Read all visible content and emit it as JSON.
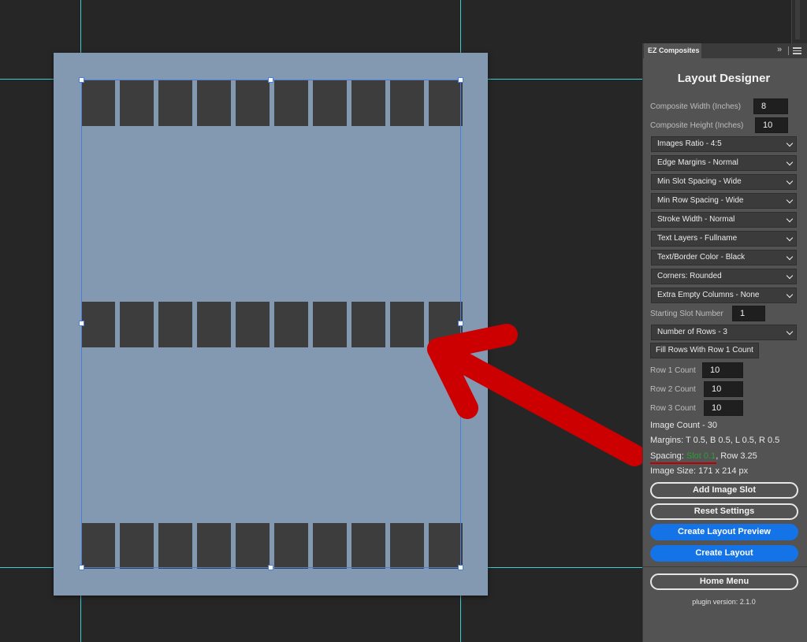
{
  "panel": {
    "tab_label": "EZ Composites",
    "collapse_icon": "double-chevron-right-icon",
    "menu_icon": "hamburger-menu-icon",
    "title": "Layout Designer",
    "composite_width_label": "Composite Width (Inches)",
    "composite_width_value": "8",
    "composite_height_label": "Composite Height (Inches)",
    "composite_height_value": "10",
    "dropdowns": [
      "Images Ratio - 4:5",
      "Edge Margins - Normal",
      "Min Slot Spacing - Wide",
      "Min Row Spacing - Wide",
      "Stroke Width - Normal",
      "Text Layers - Fullname",
      "Text/Border Color - Black",
      "Corners: Rounded",
      "Extra Empty Columns - None"
    ],
    "starting_slot_label": "Starting Slot Number",
    "starting_slot_value": "1",
    "rows_dropdown": "Number of Rows - 3",
    "fill_rows_button": "Fill Rows With Row 1 Count",
    "row_counts": [
      {
        "label": "Row 1 Count",
        "value": "10"
      },
      {
        "label": "Row 2 Count",
        "value": "10"
      },
      {
        "label": "Row 3 Count",
        "value": "10"
      }
    ],
    "image_count": "Image Count - 30",
    "margins": "Margins: T 0.5, B 0.5, L 0.5, R 0.5",
    "spacing_prefix": "Spacing: ",
    "spacing_slot": "Slot 0.1",
    "spacing_row": ", Row 3.25",
    "image_size": "Image Size: 171 x 214 px",
    "add_slot_button": "Add Image Slot",
    "reset_button": "Reset Settings",
    "preview_button": "Create Layout Preview",
    "create_button": "Create Layout",
    "home_button": "Home Menu",
    "version": "plugin version: 2.1.0"
  },
  "canvas": {
    "rows": 3,
    "columns": 10,
    "slot_color": "#3d3d3d",
    "document_color": "#8399b2",
    "guide_color": "#3fd0d6"
  },
  "annotation": {
    "arrow_color": "#cc0000",
    "underline_color": "#c00000",
    "highlight_color": "#2f9e33"
  }
}
